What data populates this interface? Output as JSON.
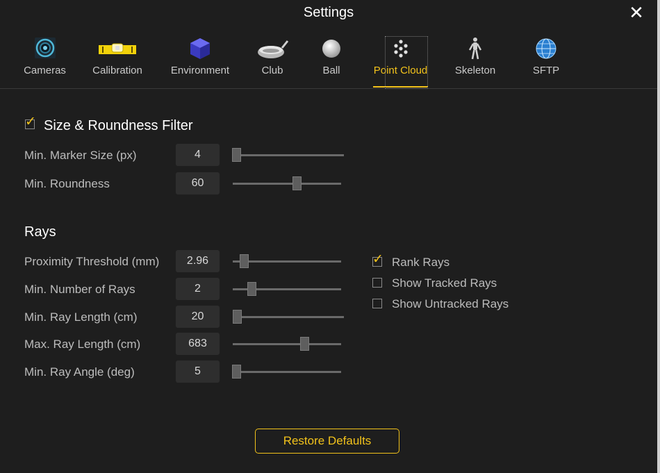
{
  "window": {
    "title": "Settings"
  },
  "tabs": [
    {
      "id": "cameras",
      "label": "Cameras",
      "icon": "camera-lens-icon",
      "active": false
    },
    {
      "id": "calibration",
      "label": "Calibration",
      "icon": "level-icon",
      "active": false
    },
    {
      "id": "environment",
      "label": "Environment",
      "icon": "cube-icon",
      "active": false
    },
    {
      "id": "club",
      "label": "Club",
      "icon": "golf-club-icon",
      "active": false
    },
    {
      "id": "ball",
      "label": "Ball",
      "icon": "ball-icon",
      "active": false
    },
    {
      "id": "point_cloud",
      "label": "Point Cloud",
      "icon": "point-cloud-icon",
      "active": true
    },
    {
      "id": "skeleton",
      "label": "Skeleton",
      "icon": "skeleton-icon",
      "active": false
    },
    {
      "id": "sftp",
      "label": "SFTP",
      "icon": "globe-icon",
      "active": false
    }
  ],
  "filter": {
    "title": "Size & Roundness Filter",
    "enabled": true,
    "rows": [
      {
        "label": "Min. Marker Size (px)",
        "value": "4",
        "fraction": 0.0
      },
      {
        "label": "Min. Roundness",
        "value": "60",
        "fraction": 0.6
      }
    ]
  },
  "rays": {
    "title": "Rays",
    "rows": [
      {
        "label": "Proximity Threshold (mm)",
        "value": "2.96",
        "fraction": 0.07
      },
      {
        "label": "Min. Number of Rays",
        "value": "2",
        "fraction": 0.15
      },
      {
        "label": "Min. Ray Length (cm)",
        "value": "20",
        "fraction": 0.0
      },
      {
        "label": "Max. Ray Length (cm)",
        "value": "683",
        "fraction": 0.68
      },
      {
        "label": "Min. Ray Angle (deg)",
        "value": "5",
        "fraction": 0.0
      }
    ],
    "options": [
      {
        "label": "Rank Rays",
        "checked": true
      },
      {
        "label": "Show Tracked Rays",
        "checked": false
      },
      {
        "label": "Show Untracked Rays",
        "checked": false
      }
    ]
  },
  "footer": {
    "restore_label": "Restore Defaults"
  },
  "colors": {
    "accent": "#f2c21b",
    "background": "#1e1e1e"
  }
}
